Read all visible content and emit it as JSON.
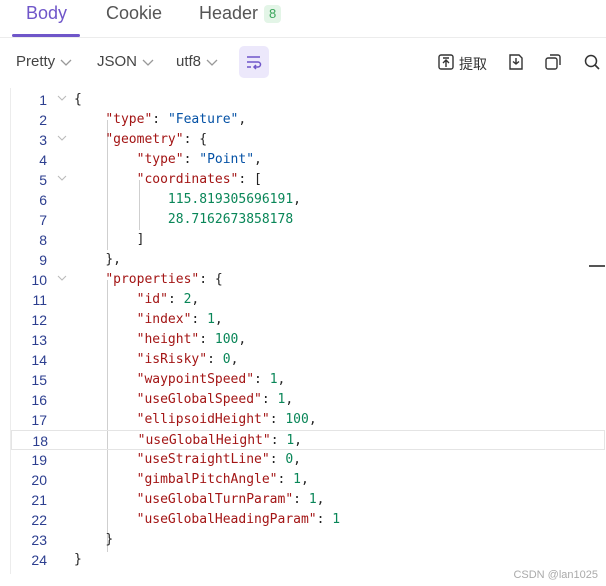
{
  "tabs": [
    {
      "label": "Body",
      "active": true
    },
    {
      "label": "Cookie",
      "active": false
    },
    {
      "label": "Header",
      "active": false,
      "badge": "8"
    }
  ],
  "toolbar": {
    "format": "Pretty",
    "language": "JSON",
    "encoding": "utf8",
    "extract_label": "提取",
    "icons": [
      "wrap-lines-icon",
      "extract-icon",
      "download-icon",
      "copy-icon",
      "search-icon"
    ]
  },
  "editor": {
    "current_line": 18,
    "lines": [
      {
        "n": "1",
        "code": "{"
      },
      {
        "n": "2",
        "code": "    \"type\": \"Feature\","
      },
      {
        "n": "3",
        "code": "    \"geometry\": {"
      },
      {
        "n": "4",
        "code": "        \"type\": \"Point\","
      },
      {
        "n": "5",
        "code": "        \"coordinates\": ["
      },
      {
        "n": "6",
        "code": "            115.819305696191,"
      },
      {
        "n": "7",
        "code": "            28.7162673858178"
      },
      {
        "n": "8",
        "code": "        ]"
      },
      {
        "n": "9",
        "code": "    },"
      },
      {
        "n": "10",
        "code": "    \"properties\": {"
      },
      {
        "n": "11",
        "code": "        \"id\": 2,"
      },
      {
        "n": "12",
        "code": "        \"index\": 1,"
      },
      {
        "n": "13",
        "code": "        \"height\": 100,"
      },
      {
        "n": "14",
        "code": "        \"isRisky\": 0,"
      },
      {
        "n": "15",
        "code": "        \"waypointSpeed\": 1,"
      },
      {
        "n": "16",
        "code": "        \"useGlobalSpeed\": 1,"
      },
      {
        "n": "17",
        "code": "        \"ellipsoidHeight\": 100,"
      },
      {
        "n": "18",
        "code": "        \"useGlobalHeight\": 1,"
      },
      {
        "n": "19",
        "code": "        \"useStraightLine\": 0,"
      },
      {
        "n": "20",
        "code": "        \"gimbalPitchAngle\": 1,"
      },
      {
        "n": "21",
        "code": "        \"useGlobalTurnParam\": 1,"
      },
      {
        "n": "22",
        "code": "        \"useGlobalHeadingParam\": 1"
      },
      {
        "n": "23",
        "code": "    }"
      },
      {
        "n": "24",
        "code": "}"
      }
    ]
  },
  "watermark": "CSDN @lan1025",
  "colors": {
    "accent": "#6f56c9",
    "key": "#a31515",
    "string": "#0451a5",
    "number": "#098658"
  }
}
